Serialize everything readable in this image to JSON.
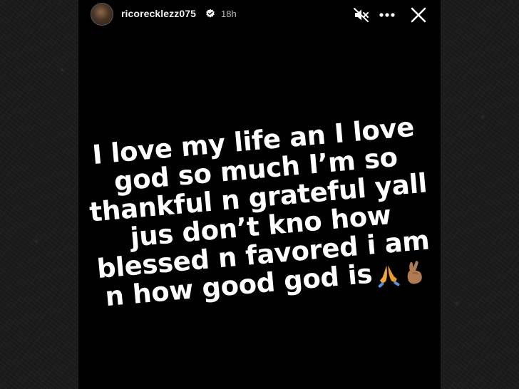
{
  "story": {
    "username": "ricorecklezz075",
    "time": "18h",
    "text_lines": [
      "I love my life an I love",
      "god so much I’m so",
      "thankful n grateful yall",
      "jus don’t kno how",
      "blessed n favored i am",
      "n how good god is"
    ],
    "emojis": [
      "praying-hands-emoji",
      "crossed-fingers-emoji"
    ]
  },
  "icons": {
    "verified": "verified-badge-icon",
    "mute": "speaker-muted-icon",
    "more": "more-options-icon",
    "close": "close-icon"
  },
  "colors": {
    "background": "#000000",
    "text": "#ffffff",
    "secondary_text": "#bdbdbd"
  }
}
